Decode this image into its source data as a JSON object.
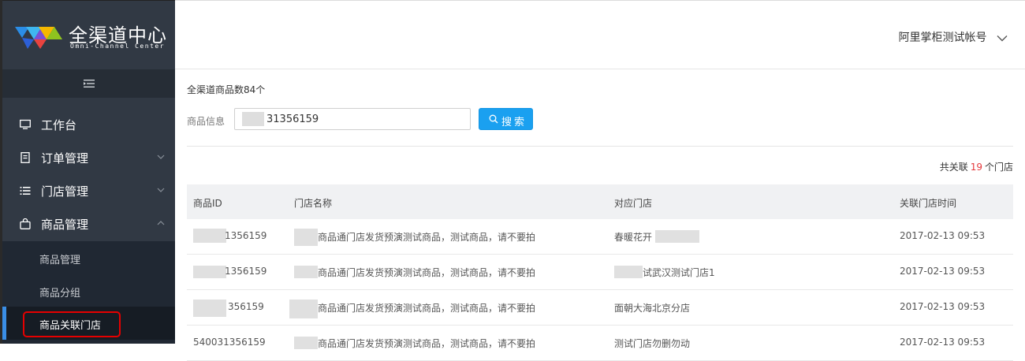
{
  "brand": {
    "title": "全渠道中心",
    "subtitle": "Omni-Channel Center"
  },
  "sidebar": {
    "items": [
      {
        "label": "工作台",
        "icon": "monitor-icon"
      },
      {
        "label": "订单管理",
        "icon": "order-icon"
      },
      {
        "label": "门店管理",
        "icon": "list-icon"
      },
      {
        "label": "商品管理",
        "icon": "bag-icon"
      }
    ],
    "submenu": [
      {
        "label": "商品管理"
      },
      {
        "label": "商品分组"
      },
      {
        "label": "商品关联门店"
      }
    ]
  },
  "header": {
    "account_name": "阿里掌柜测试帐号"
  },
  "main": {
    "count_text": "全渠道商品数84个",
    "filter_label": "商品信息",
    "search_value": "31356159",
    "search_button": "搜索",
    "relation": {
      "prefix": "共关联",
      "count": "19",
      "suffix": "个门店"
    }
  },
  "table": {
    "columns": [
      "商品ID",
      "门店名称",
      "对应门店",
      "关联门店时间"
    ],
    "rows": [
      [
        "1356159",
        "商品通门店发货预演测试商品，测试商品，请不要拍",
        "春暖花开",
        "2017-02-13 09:53"
      ],
      [
        "1356159",
        "商品通门店发货预演测试商品，测试商品，请不要拍",
        "试武汉测试门店1",
        "2017-02-13 09:53"
      ],
      [
        "356159",
        "商品通门店发货预演测试商品，测试商品，请不要拍",
        "面朝大海北京分店",
        "2017-02-13 09:53"
      ],
      [
        "540031356159",
        "商品通门店发货预演测试商品，测试商品，请不要拍",
        "测试门店勿删勿动",
        "2017-02-13 09:53"
      ]
    ]
  },
  "colors": {
    "sidebar_bg": "#313944",
    "accent": "#1aa0f0",
    "highlight": "#e60000",
    "count_red": "#e4393c"
  }
}
